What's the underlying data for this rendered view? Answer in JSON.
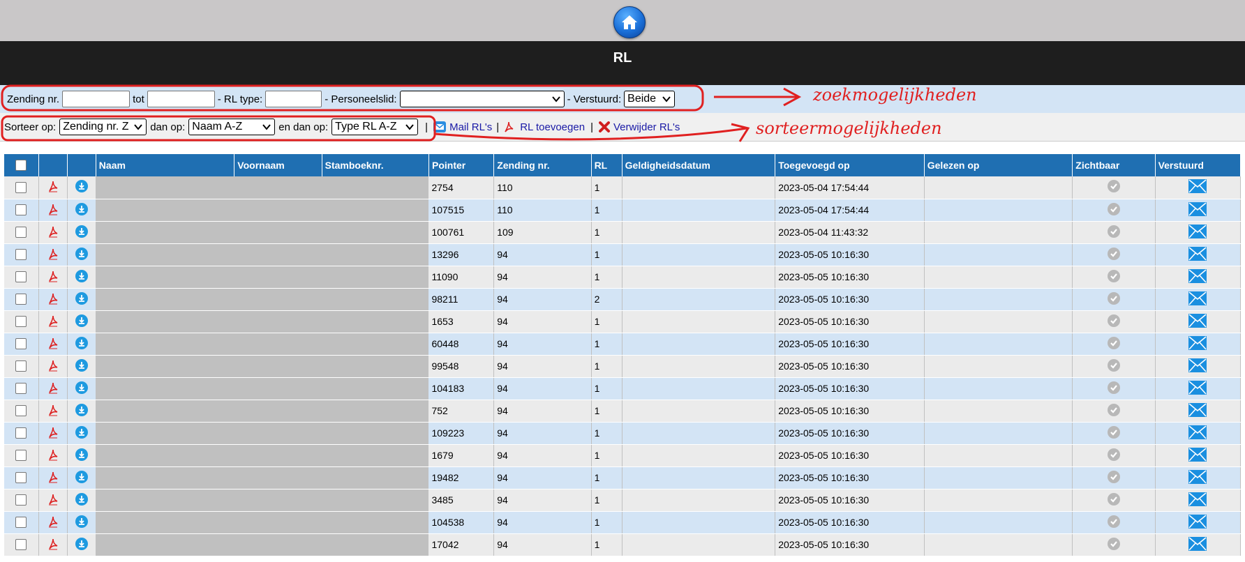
{
  "page": {
    "title": "RL"
  },
  "search": {
    "zending_label": "Zending nr.",
    "tot_label": "tot",
    "rltype_label": "- RL type:",
    "personeel_label": "- Personeelslid:",
    "verstuurd_label": "- Verstuurd:",
    "verstuurd_value": "Beide",
    "zending_from": "",
    "zending_to": "",
    "rltype_value": "",
    "personeel_value": ""
  },
  "sort": {
    "label": "Sorteer op:",
    "first_value": "Zending nr. Z",
    "then_label": "dan op:",
    "second_value": "Naam A-Z",
    "and_then_label": "en dan op:",
    "third_value": "Type RL A-Z",
    "mail_label": "Mail RL's",
    "add_label": "RL toevoegen",
    "delete_label": "Verwijder RL's",
    "divider": "|"
  },
  "annotations": {
    "search_note": "zoekmogelijkheden",
    "sort_note": "sorteermogelijkheden",
    "color": "#e02020"
  },
  "table": {
    "headers": [
      "Naam",
      "Voornaam",
      "Stamboeknr.",
      "Pointer",
      "Zending nr.",
      "RL",
      "Geldigheidsdatum",
      "Toegevoegd op",
      "Gelezen op",
      "Zichtbaar",
      "Verstuurd"
    ],
    "rows": [
      {
        "pointer": "2754",
        "zending": "110",
        "rl": "1",
        "toegevoegd": "2023-05-04 17:54:44"
      },
      {
        "pointer": "107515",
        "zending": "110",
        "rl": "1",
        "toegevoegd": "2023-05-04 17:54:44"
      },
      {
        "pointer": "100761",
        "zending": "109",
        "rl": "1",
        "toegevoegd": "2023-05-04 11:43:32"
      },
      {
        "pointer": "13296",
        "zending": "94",
        "rl": "1",
        "toegevoegd": "2023-05-05 10:16:30"
      },
      {
        "pointer": "11090",
        "zending": "94",
        "rl": "1",
        "toegevoegd": "2023-05-05 10:16:30"
      },
      {
        "pointer": "98211",
        "zending": "94",
        "rl": "2",
        "toegevoegd": "2023-05-05 10:16:30"
      },
      {
        "pointer": "1653",
        "zending": "94",
        "rl": "1",
        "toegevoegd": "2023-05-05 10:16:30"
      },
      {
        "pointer": "60448",
        "zending": "94",
        "rl": "1",
        "toegevoegd": "2023-05-05 10:16:30"
      },
      {
        "pointer": "99548",
        "zending": "94",
        "rl": "1",
        "toegevoegd": "2023-05-05 10:16:30"
      },
      {
        "pointer": "104183",
        "zending": "94",
        "rl": "1",
        "toegevoegd": "2023-05-05 10:16:30"
      },
      {
        "pointer": "752",
        "zending": "94",
        "rl": "1",
        "toegevoegd": "2023-05-05 10:16:30"
      },
      {
        "pointer": "109223",
        "zending": "94",
        "rl": "1",
        "toegevoegd": "2023-05-05 10:16:30"
      },
      {
        "pointer": "1679",
        "zending": "94",
        "rl": "1",
        "toegevoegd": "2023-05-05 10:16:30"
      },
      {
        "pointer": "19482",
        "zending": "94",
        "rl": "1",
        "toegevoegd": "2023-05-05 10:16:30"
      },
      {
        "pointer": "3485",
        "zending": "94",
        "rl": "1",
        "toegevoegd": "2023-05-05 10:16:30"
      },
      {
        "pointer": "104538",
        "zending": "94",
        "rl": "1",
        "toegevoegd": "2023-05-05 10:16:30"
      },
      {
        "pointer": "17042",
        "zending": "94",
        "rl": "1",
        "toegevoegd": "2023-05-05 10:16:30"
      }
    ]
  }
}
